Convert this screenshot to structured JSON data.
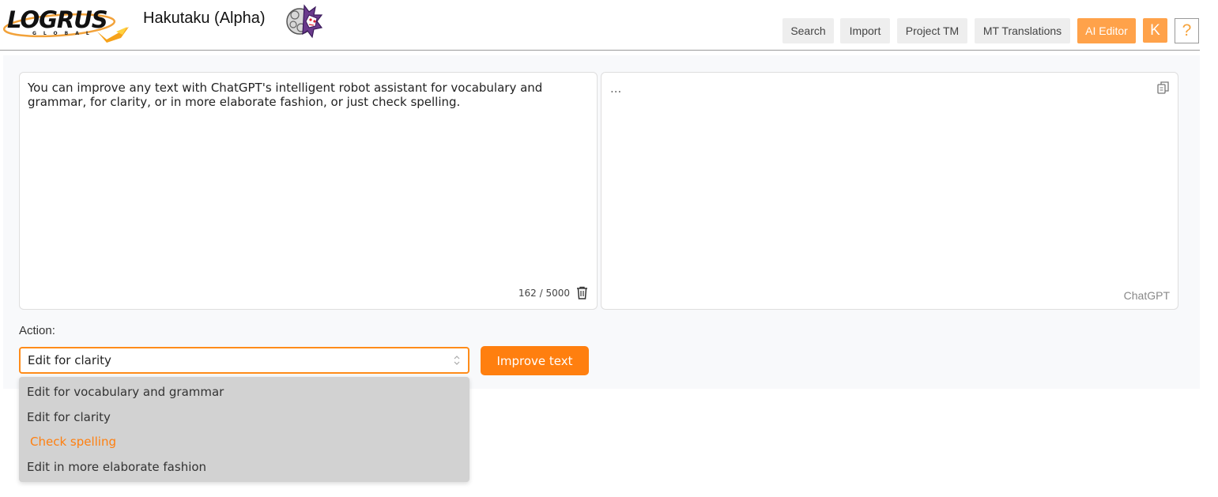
{
  "header": {
    "logo_text": "LOGRUS",
    "logo_subtext": "GLOBAL",
    "app_title": "Hakutaku (Alpha)",
    "nav": [
      {
        "label": "Search",
        "active": false
      },
      {
        "label": "Import",
        "active": false
      },
      {
        "label": "Project TM",
        "active": false
      },
      {
        "label": "MT Translations",
        "active": false
      },
      {
        "label": "AI Editor",
        "active": true
      }
    ],
    "avatar_initial": "K",
    "help_label": "?",
    "accent_color": "#ffa24a"
  },
  "editor": {
    "source_text": "You can improve any text with ChatGPT's intelligent robot assistant for vocabulary and grammar, for clarity, or in more elaborate fashion, or just check spelling.",
    "char_count": "162 / 5000",
    "output_text": "...",
    "engine_label": "ChatGPT"
  },
  "action": {
    "label": "Action:",
    "selected": "Edit for clarity",
    "submit_label": "Improve text",
    "options": [
      "Edit for vocabulary and grammar",
      "Edit for clarity",
      "Check spelling",
      "Edit in more elaborate fashion"
    ],
    "hovered_option": "Check spelling",
    "button_color": "#ff7f0f"
  }
}
